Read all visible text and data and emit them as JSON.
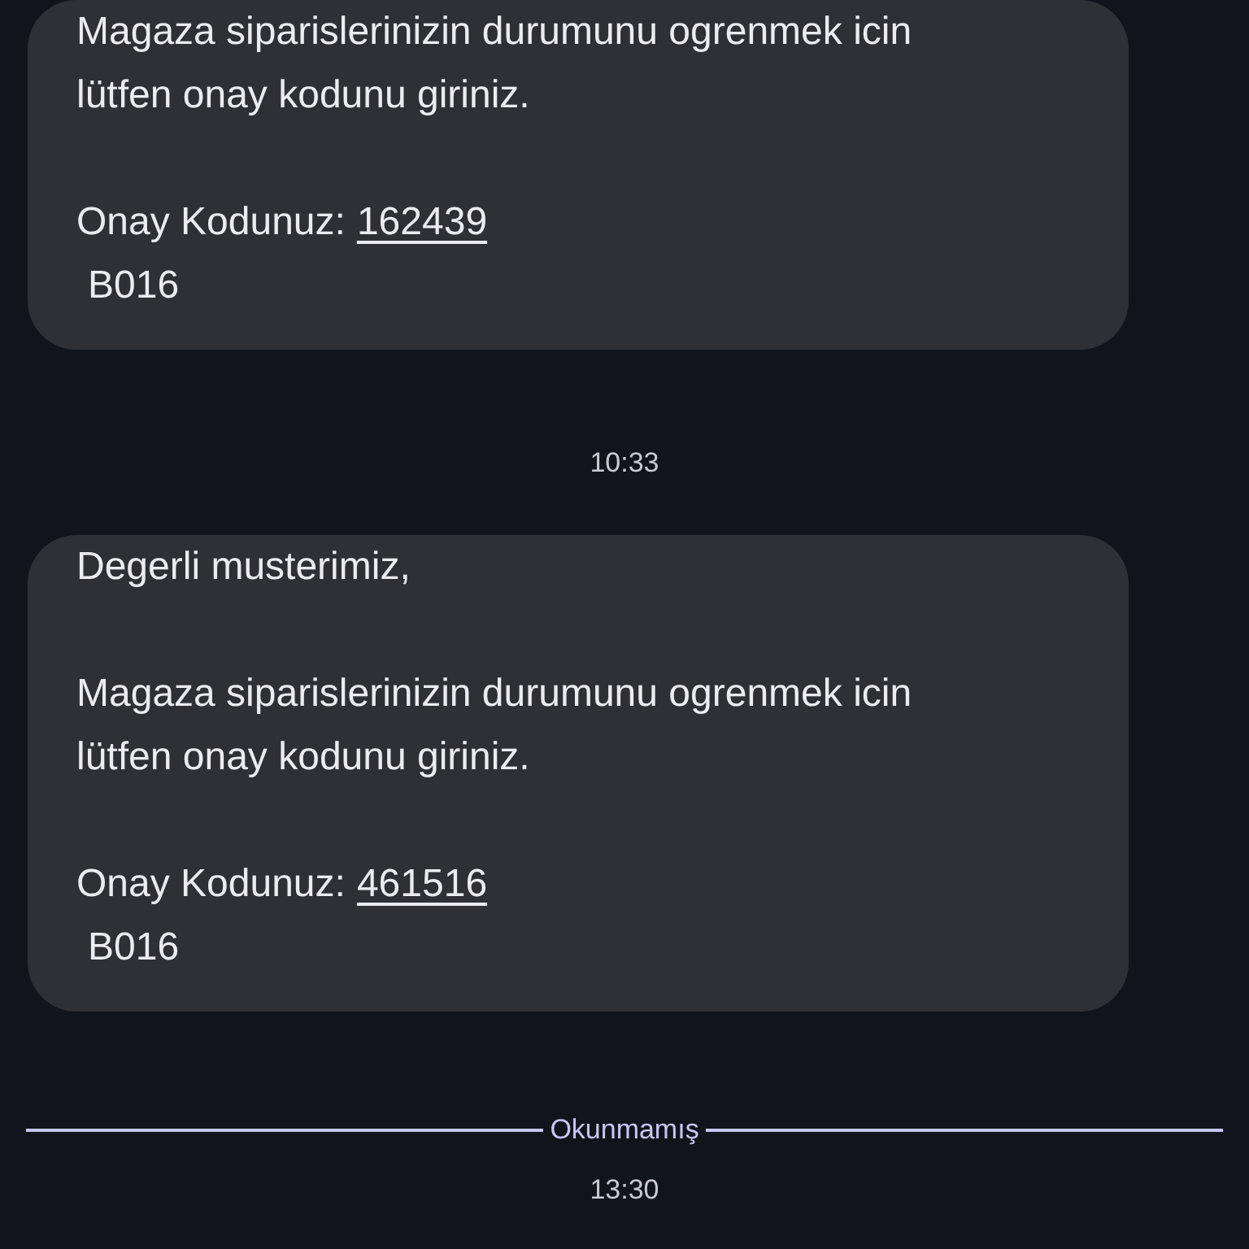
{
  "messages": [
    {
      "paragraphs": [
        {
          "kind": "text",
          "lines": [
            "Magaza siparislerinizin durumunu ogrenmek icin",
            "lütfen onay kodunu giriniz."
          ]
        },
        {
          "kind": "code",
          "label": "Onay Kodunuz:",
          "code": "162439",
          "suffix": "B016"
        }
      ]
    },
    {
      "time": "10:33",
      "paragraphs": [
        {
          "kind": "text",
          "lines": [
            "Degerli musterimiz,"
          ]
        },
        {
          "kind": "text",
          "lines": [
            "Magaza siparislerinizin durumunu ogrenmek icin",
            "lütfen onay kodunu giriniz."
          ]
        },
        {
          "kind": "code",
          "label": "Onay Kodunuz:",
          "code": "461516",
          "suffix": "B016"
        }
      ]
    }
  ],
  "unread_divider": {
    "label": "Okunmamış"
  },
  "last_time": "13:30"
}
